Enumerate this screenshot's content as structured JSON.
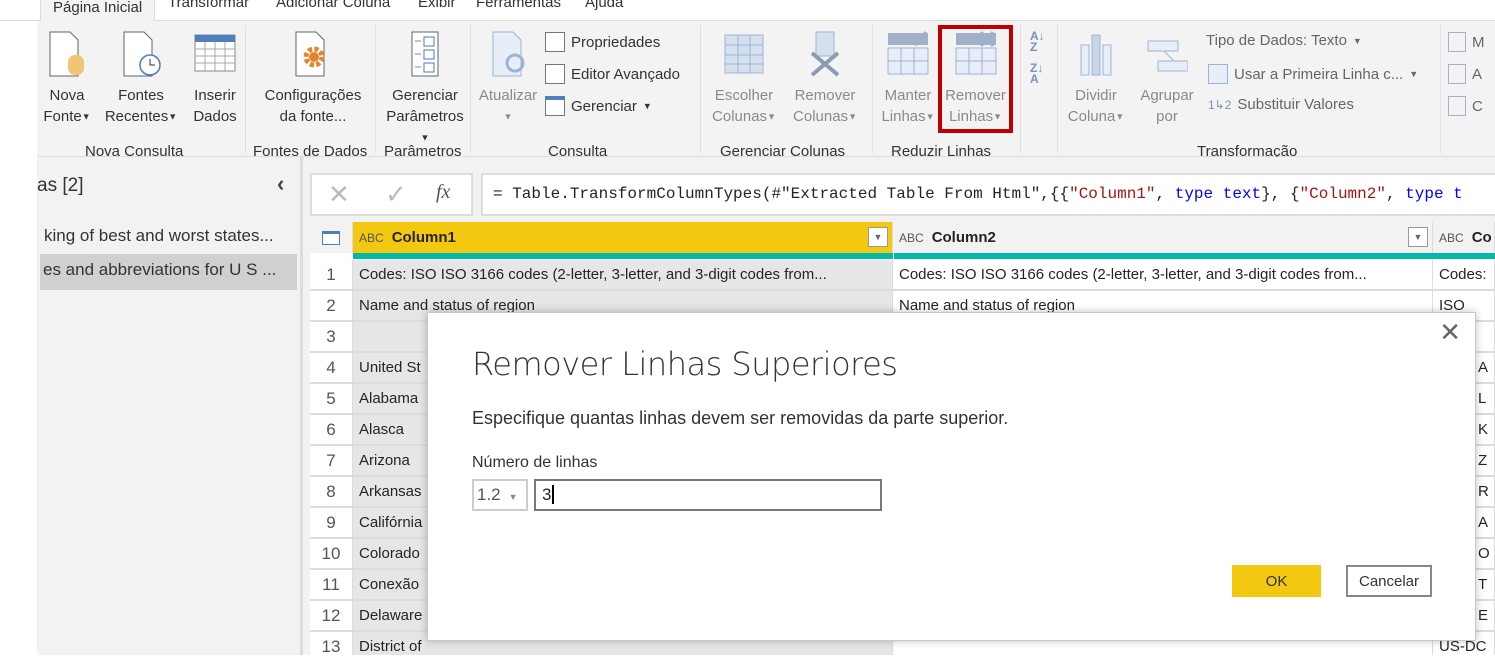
{
  "tabs": [
    "Página Inicial",
    "Transformar",
    "Adicionar Coluna",
    "Exibir",
    "Ferramentas",
    "Ajuda"
  ],
  "ribbon": {
    "nova_fonte": [
      "Nova",
      "Fonte"
    ],
    "fontes_recentes": [
      "Fontes",
      "Recentes"
    ],
    "inserir_dados": [
      "Inserir",
      "Dados"
    ],
    "config_fonte": [
      "Configurações",
      "da fonte..."
    ],
    "gerenciar_parametros": [
      "Gerenciar",
      "Parâmetros"
    ],
    "atualizar": "Atualizar",
    "propriedades": "Propriedades",
    "editor_avancado": "Editor Avançado",
    "gerenciar": "Gerenciar",
    "escolher_colunas": [
      "Escolher",
      "Colunas"
    ],
    "remover_colunas": [
      "Remover",
      "Colunas"
    ],
    "manter_linhas": [
      "Manter",
      "Linhas"
    ],
    "remover_linhas": [
      "Remover",
      "Linhas"
    ],
    "dividir_coluna": [
      "Dividir",
      "Coluna"
    ],
    "agrupar_por": [
      "Agrupar",
      "por"
    ],
    "tipo_dados": "Tipo de Dados: Texto",
    "usar_primeira_linha": "Usar a Primeira Linha c...",
    "substituir_valores": "Substituir Valores",
    "partial_items": [
      "M",
      "A",
      "C"
    ],
    "groups": [
      "Nova Consulta",
      "Fontes de Dados",
      "Parâmetros",
      "Consulta",
      "Gerenciar Colunas",
      "Reduzir Linhas",
      "Transformação"
    ],
    "highlight_color": "#c00000"
  },
  "queries": {
    "title": "as [2]",
    "items": [
      "king of best and worst states...",
      "es and abbreviations for U S ..."
    ],
    "selected": 1
  },
  "formula": {
    "prefix": "= Table.TransformColumnTypes(#\"Extracted Table From Html\",{{",
    "s1": "\"Column1\"",
    "m1": ", ",
    "k1": "type text",
    "m2": "}, {",
    "s2": "\"Column2\"",
    "m3": ", ",
    "k2": "type t"
  },
  "table": {
    "columns": [
      "Column1",
      "Column2",
      "Co"
    ],
    "type_icon": "ABC",
    "rows": [
      {
        "n": "1",
        "c1": "Codes:    ISO ISO 3166 codes (2-letter, 3-letter, and 3-digit codes from...",
        "c2": "Codes:    ISO ISO 3166 codes (2-letter, 3-letter, and 3-digit codes from...",
        "c3": "Codes:"
      },
      {
        "n": "2",
        "c1": "Name and status of region",
        "c2": "Name and status of region",
        "c3": "ISO"
      },
      {
        "n": "3",
        "c1": "",
        "c2": "",
        "c3": ""
      },
      {
        "n": "4",
        "c1": "United St",
        "c2": "",
        "c3": "A"
      },
      {
        "n": "5",
        "c1": "Alabama",
        "c2": "",
        "c3": "L"
      },
      {
        "n": "6",
        "c1": "Alasca",
        "c2": "",
        "c3": "K"
      },
      {
        "n": "7",
        "c1": "Arizona",
        "c2": "",
        "c3": "Z"
      },
      {
        "n": "8",
        "c1": "Arkansas",
        "c2": "",
        "c3": "R"
      },
      {
        "n": "9",
        "c1": "Califórnia",
        "c2": "",
        "c3": "A"
      },
      {
        "n": "10",
        "c1": "Colorado",
        "c2": "",
        "c3": "O"
      },
      {
        "n": "11",
        "c1": "Conexão",
        "c2": "",
        "c3": "T"
      },
      {
        "n": "12",
        "c1": "Delaware",
        "c2": "",
        "c3": "E"
      },
      {
        "n": "13",
        "c1": "District of",
        "c2": "",
        "c3": "US-DC"
      }
    ],
    "selected_column_color": "#f2c811",
    "quality_bar_color": "#01b8aa"
  },
  "dialog": {
    "title": "Remover Linhas Superiores",
    "description": "Especifique quantas linhas devem ser removidas da parte superior.",
    "field_label": "Número de linhas",
    "type_select": "1.2",
    "value": "3",
    "ok": "OK",
    "cancel": "Cancelar"
  }
}
